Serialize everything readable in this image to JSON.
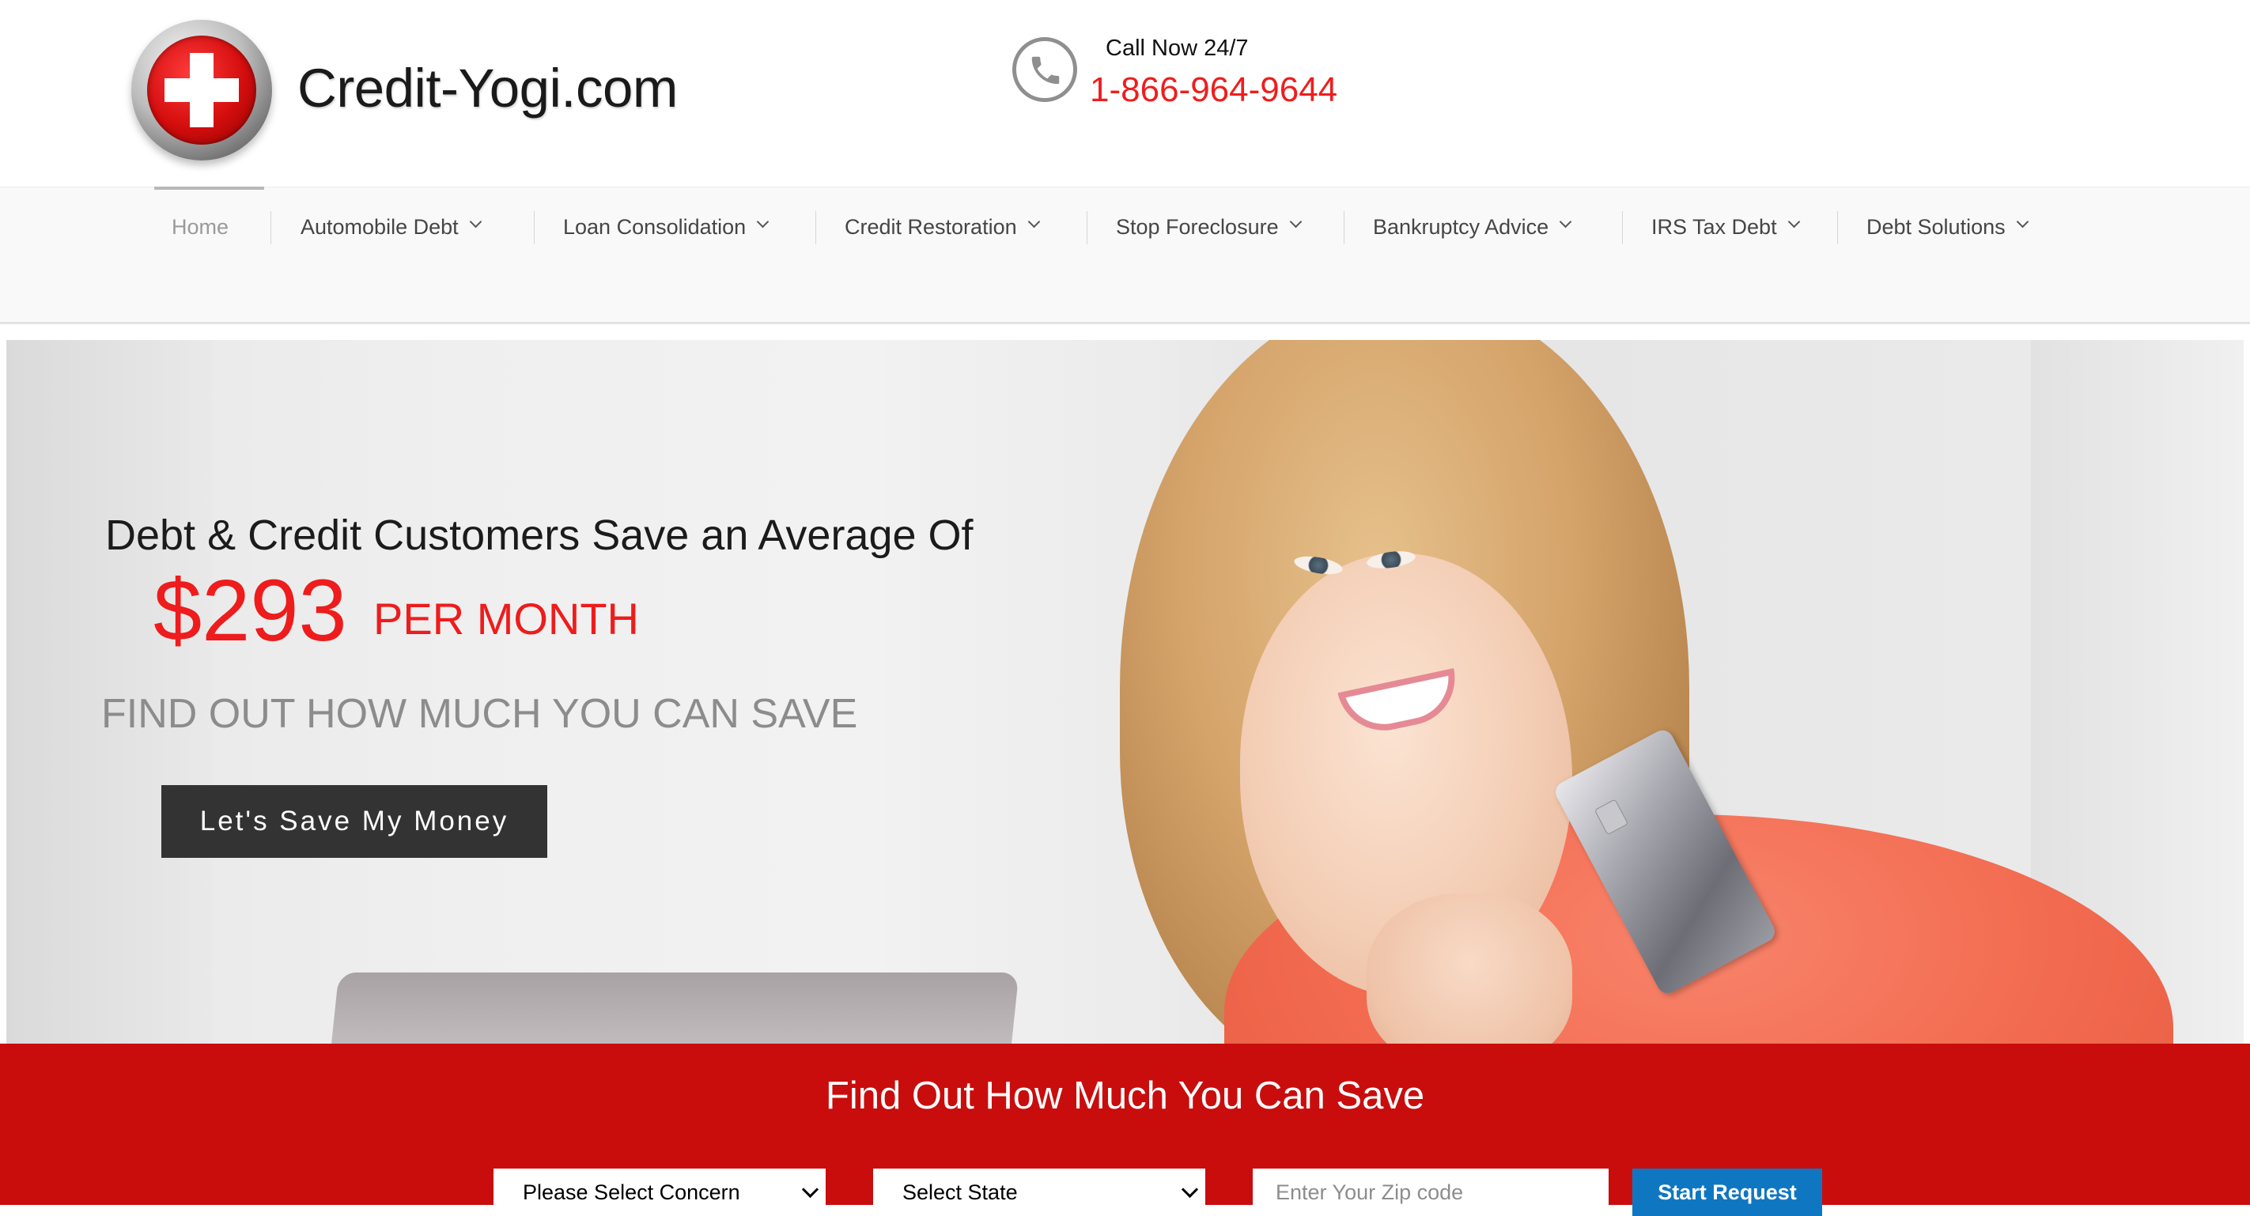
{
  "brand": {
    "name": "Credit-Yogi.com",
    "logo_icon": "red-cross-badge-icon"
  },
  "contact": {
    "label": "Call Now 24/7",
    "phone": "1-866-964-9644",
    "icon": "phone-icon"
  },
  "nav": {
    "items": [
      {
        "label": "Home",
        "active": true,
        "dropdown": false
      },
      {
        "label": "Automobile Debt",
        "active": false,
        "dropdown": true
      },
      {
        "label": "Loan Consolidation",
        "active": false,
        "dropdown": true
      },
      {
        "label": "Credit Restoration",
        "active": false,
        "dropdown": true
      },
      {
        "label": "Stop Foreclosure",
        "active": false,
        "dropdown": true
      },
      {
        "label": "Bankruptcy Advice",
        "active": false,
        "dropdown": true
      },
      {
        "label": "IRS Tax Debt",
        "active": false,
        "dropdown": true
      },
      {
        "label": "Debt Solutions",
        "active": false,
        "dropdown": true
      }
    ]
  },
  "hero": {
    "headline": "Debt & Credit Customers Save an Average Of",
    "amount": "$293",
    "per_month": "PER MONTH",
    "subhead": "FIND OUT HOW MUCH YOU CAN SAVE",
    "cta_label": "Let's Save My Money"
  },
  "form": {
    "title": "Find Out How Much You Can Save",
    "concern_selected": "Please Select Concern",
    "state_selected": "Select State",
    "zip_placeholder": "Enter Your Zip code",
    "submit_label": "Start Request"
  },
  "colors": {
    "brand_red": "#c90d0d",
    "accent_red": "#ee1c1c",
    "button_dark": "#333333",
    "button_blue": "#0f77c2"
  }
}
